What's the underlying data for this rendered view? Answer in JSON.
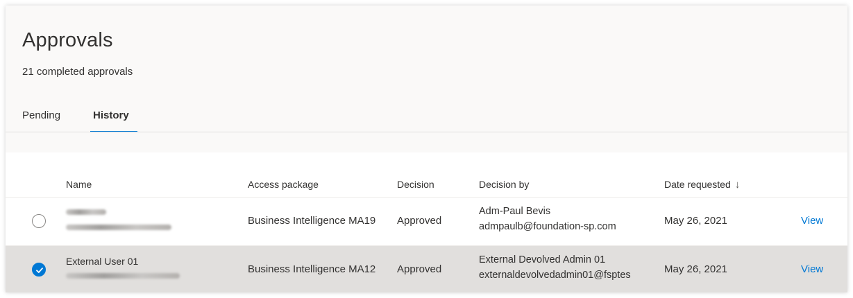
{
  "page": {
    "title": "Approvals",
    "subtitle": "21 completed approvals"
  },
  "tabs": [
    {
      "label": "Pending",
      "selected": false
    },
    {
      "label": "History",
      "selected": true
    }
  ],
  "table": {
    "columns": [
      "Name",
      "Access package",
      "Decision",
      "Decision by",
      "Date requested"
    ],
    "sort": {
      "column": "Date requested",
      "direction": "descending",
      "icon": "arrow-down-icon"
    },
    "rows": [
      {
        "selected": false,
        "name": "",
        "name_sub": "",
        "access_package": "Business Intelligence MA19",
        "decision": "Approved",
        "decision_by_name": "Adm-Paul Bevis",
        "decision_by_email": "admpaulb@foundation-sp.com",
        "date_requested": "May 26, 2021",
        "action": "View"
      },
      {
        "selected": true,
        "name": "External User 01",
        "name_sub": "",
        "access_package": "Business Intelligence MA12",
        "decision": "Approved",
        "decision_by_name": "External Devolved Admin 01",
        "decision_by_email": "externaldevolvedadmin01@fsptes",
        "date_requested": "May 26, 2021",
        "action": "View"
      }
    ]
  },
  "colors": {
    "accent": "#0078d4",
    "selected_row": "#e1dfdd",
    "header_band": "#faf9f8"
  }
}
